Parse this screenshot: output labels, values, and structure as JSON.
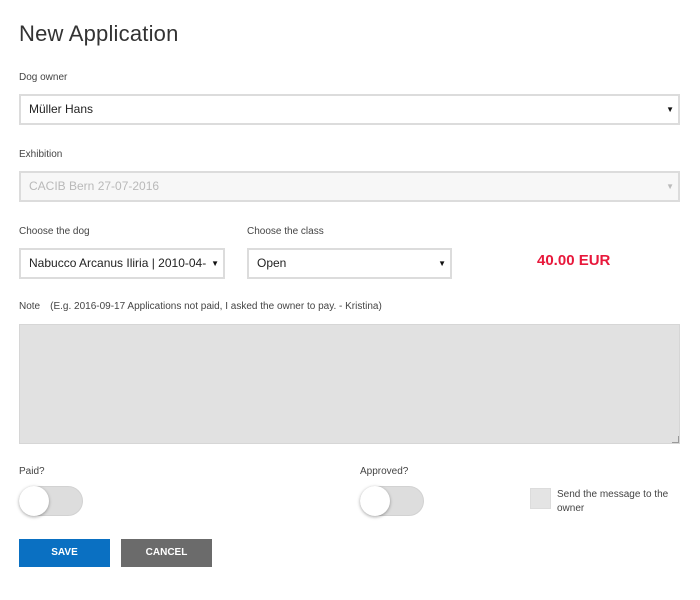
{
  "page": {
    "title": "New Application"
  },
  "form": {
    "dog_owner": {
      "label": "Dog owner",
      "value": "Müller Hans"
    },
    "exhibition": {
      "label": "Exhibition",
      "value": "CACIB Bern 27-07-2016",
      "disabled": true
    },
    "dog": {
      "label": "Choose the dog",
      "value": "Nabucco Arcanus Iliria | 2010-04-"
    },
    "class": {
      "label": "Choose the class",
      "value": "Open"
    },
    "price": "40.00 EUR",
    "note": {
      "label": "Note",
      "hint": "(E.g. 2016-09-17 Applications not paid, I asked the owner to pay. - Kristina)",
      "value": ""
    },
    "paid": {
      "label": "Paid?",
      "checked": false
    },
    "approved": {
      "label": "Approved?",
      "checked": false
    },
    "send_message": {
      "label": "Send the message to the owner",
      "checked": false
    }
  },
  "actions": {
    "save_label": "SAVE",
    "cancel_label": "CANCEL"
  },
  "colors": {
    "price": "#e8183b",
    "save_button": "#0a70c2",
    "cancel_button": "#6b6b6b",
    "note_background": "#e1e1e1"
  },
  "icons": {
    "select_caret": "▼"
  }
}
